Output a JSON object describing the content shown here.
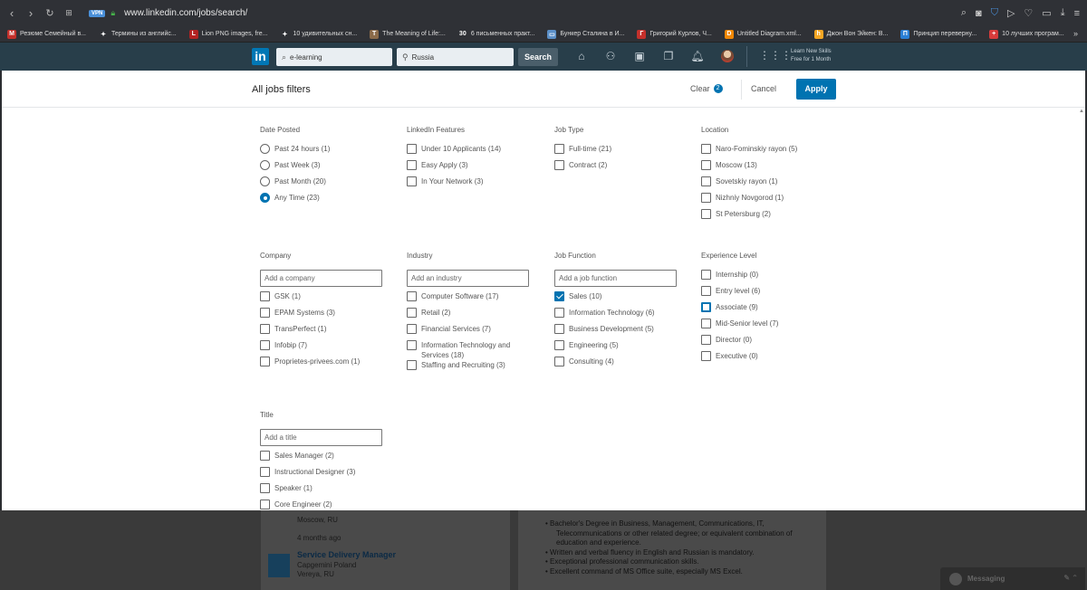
{
  "browser": {
    "url": "www.linkedin.com/jobs/search/",
    "vpn_label": "VPN",
    "bookmarks": [
      {
        "label": "Резюме Семейный в...",
        "color": "#c4302b",
        "glyph": "M"
      },
      {
        "label": "Термины из английс...",
        "color": "#2f3136",
        "glyph": "✦"
      },
      {
        "label": "Lion PNG images, fre...",
        "color": "#b22222",
        "glyph": "L"
      },
      {
        "label": "10 удивительных сн...",
        "color": "#2f3136",
        "glyph": "✦"
      },
      {
        "label": "The Meaning of Life:...",
        "color": "#8b6b4a",
        "glyph": "T"
      },
      {
        "label": "6 письменных практ...",
        "color": "#2f3136",
        "glyph": "30"
      },
      {
        "label": "Бункер Сталина в И...",
        "color": "#5b8fc7",
        "glyph": "▭"
      },
      {
        "label": "Григорий Курлов, Ч...",
        "color": "#c4302b",
        "glyph": "Г"
      },
      {
        "label": "Untitled Diagram.xml...",
        "color": "#f08705",
        "glyph": "D"
      },
      {
        "label": "Джон Вон Эйкен: В...",
        "color": "#f5a623",
        "glyph": "h"
      },
      {
        "label": "Принцип переверну...",
        "color": "#2a7fd4",
        "glyph": "П"
      },
      {
        "label": "10 лучших програм...",
        "color": "#d83b3b",
        "glyph": "+"
      }
    ],
    "more_label": "»"
  },
  "linkedin_header": {
    "logo": "in",
    "keyword_value": "e-learning",
    "location_value": "Russia",
    "search_label": "Search",
    "promo_line1": "Learn New Skills",
    "promo_line2": "Free for 1 Month"
  },
  "filters_panel": {
    "title": "All jobs filters",
    "clear_label": "Clear",
    "clear_count": "2",
    "cancel_label": "Cancel",
    "apply_label": "Apply",
    "date_posted": {
      "title": "Date Posted",
      "options": [
        {
          "label": "Past 24 hours (1)",
          "checked": false
        },
        {
          "label": "Past Week (3)",
          "checked": false
        },
        {
          "label": "Past Month (20)",
          "checked": false
        },
        {
          "label": "Any Time (23)",
          "checked": true
        }
      ]
    },
    "linkedin_features": {
      "title": "LinkedIn Features",
      "options": [
        {
          "label": "Under 10 Applicants (14)",
          "checked": false
        },
        {
          "label": "Easy Apply (3)",
          "checked": false
        },
        {
          "label": "In Your Network (3)",
          "checked": false
        }
      ]
    },
    "job_type": {
      "title": "Job Type",
      "options": [
        {
          "label": "Full-time (21)",
          "checked": false
        },
        {
          "label": "Contract (2)",
          "checked": false
        }
      ]
    },
    "location": {
      "title": "Location",
      "options": [
        {
          "label": "Naro-Fominskiy rayon (5)",
          "checked": false
        },
        {
          "label": "Moscow (13)",
          "checked": false
        },
        {
          "label": "Sovetskiy rayon (1)",
          "checked": false
        },
        {
          "label": "Nizhniy Novgorod (1)",
          "checked": false
        },
        {
          "label": "St Petersburg (2)",
          "checked": false
        }
      ]
    },
    "company": {
      "title": "Company",
      "placeholder": "Add a company",
      "options": [
        {
          "label": "GSK (1)",
          "checked": false
        },
        {
          "label": "EPAM Systems (3)",
          "checked": false
        },
        {
          "label": "TransPerfect (1)",
          "checked": false
        },
        {
          "label": "Infobip (7)",
          "checked": false
        },
        {
          "label": "Proprietes-privees.com (1)",
          "checked": false
        }
      ]
    },
    "industry": {
      "title": "Industry",
      "placeholder": "Add an industry",
      "options": [
        {
          "label": "Computer Software (17)",
          "checked": false
        },
        {
          "label": "Retail (2)",
          "checked": false
        },
        {
          "label": "Financial Services (7)",
          "checked": false
        },
        {
          "label": "Information Technology and Services (18)",
          "checked": false
        },
        {
          "label": "Staffing and Recruiting (3)",
          "checked": false
        }
      ]
    },
    "job_function": {
      "title": "Job Function",
      "placeholder": "Add a job function",
      "options": [
        {
          "label": "Sales (10)",
          "checked": true
        },
        {
          "label": "Information Technology (6)",
          "checked": false
        },
        {
          "label": "Business Development (5)",
          "checked": false
        },
        {
          "label": "Engineering (5)",
          "checked": false
        },
        {
          "label": "Consulting (4)",
          "checked": false
        }
      ]
    },
    "experience_level": {
      "title": "Experience Level",
      "options": [
        {
          "label": "Internship (0)",
          "checked": false
        },
        {
          "label": "Entry level (6)",
          "checked": false
        },
        {
          "label": "Associate (9)",
          "checked": false
        },
        {
          "label": "Mid-Senior level (7)",
          "checked": false
        },
        {
          "label": "Director (0)",
          "checked": false
        },
        {
          "label": "Executive (0)",
          "checked": false
        }
      ]
    },
    "title_filter": {
      "title": "Title",
      "placeholder": "Add a title",
      "options": [
        {
          "label": "Sales Manager (2)",
          "checked": false
        },
        {
          "label": "Instructional Designer (3)",
          "checked": false
        },
        {
          "label": "Speaker (1)",
          "checked": false
        },
        {
          "label": "Core Engineer (2)",
          "checked": false
        }
      ]
    }
  },
  "background_page": {
    "location_1": "Moscow, RU",
    "time_ago": "4 months ago",
    "job_title": "Service Delivery Manager",
    "company": "Capgemini Poland",
    "location_2": "Vereya, RU",
    "bullets": [
      "Bachelor's Degree in Business, Management, Communications, IT,",
      "Telecommunications or other related degree; or equivalent combination of",
      "education and experience.",
      "Written and verbal fluency in English and Russian is mandatory.",
      "Exceptional professional communication skills.",
      "Excellent command of MS Office suite, especially MS Excel."
    ],
    "messaging_label": "Messaging"
  }
}
